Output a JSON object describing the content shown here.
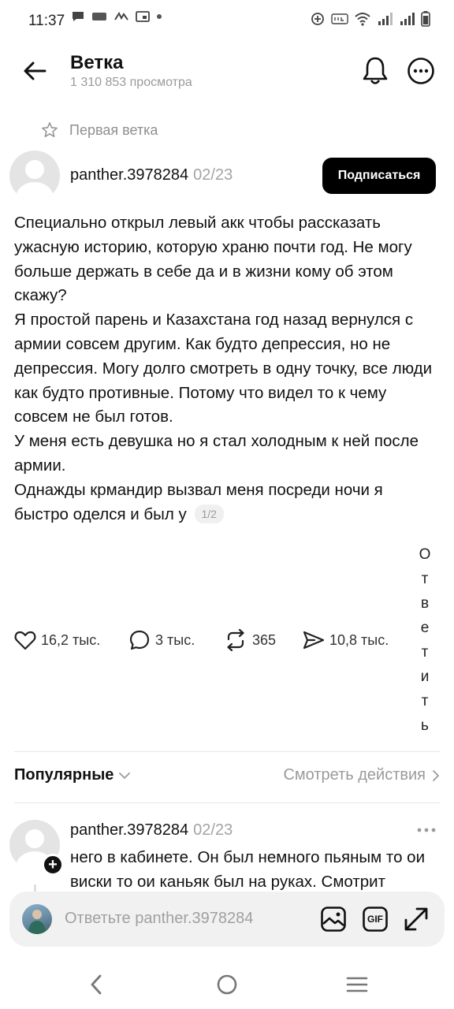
{
  "status_bar": {
    "time": "11:37"
  },
  "header": {
    "title": "Ветка",
    "views": "1 310 853 просмотра"
  },
  "pinned": {
    "label": "Первая ветка"
  },
  "post": {
    "author": "panther.3978284",
    "date": "02/23",
    "follow_label": "Подписаться",
    "paragraphs": [
      "Специально открыл левый акк чтобы рассказать ужасную историю, которую храню почти год. Не могу больше держать в себе да и в жизни кому об этом скажу?",
      "Я простой парень и Казахстана год назад вернулся с армии совсем другим. Как будто депрессия, но не депрессия. Могу долго смотреть в одну точку, все люди как будто противные. Потому что видел то к чему совсем не был готов.",
      "У меня есть девушка но я стал холодным к ней после армии.",
      "Однажды крмандир вызвал меня посреди ночи я быстро оделся и был у"
    ],
    "page_indicator": "1/2",
    "reply_label_letters": [
      "О",
      "т",
      "в",
      "е",
      "т",
      "и",
      "т",
      "ь"
    ],
    "likes": "16,2 тыс.",
    "comments": "3 тыс.",
    "reposts": "365",
    "shares": "10,8 тыс."
  },
  "sort": {
    "label": "Популярные",
    "view_actions": "Смотреть действия"
  },
  "reply": {
    "author": "panther.3978284",
    "date": "02/23",
    "text": "него в кабинете. Он был немного пьяным то ои виски то ои каньяк был на руках. Смотрит"
  },
  "composer": {
    "placeholder": "Ответьте panther.3978284",
    "gif_label": "GIF"
  },
  "icons": {
    "back": "arrow-left-icon",
    "bell": "bell-icon",
    "more": "more-circle-icon",
    "pin": "star-icon",
    "like": "heart-icon",
    "comment": "comment-bubble-icon",
    "repost": "repost-icon",
    "share": "send-icon"
  }
}
